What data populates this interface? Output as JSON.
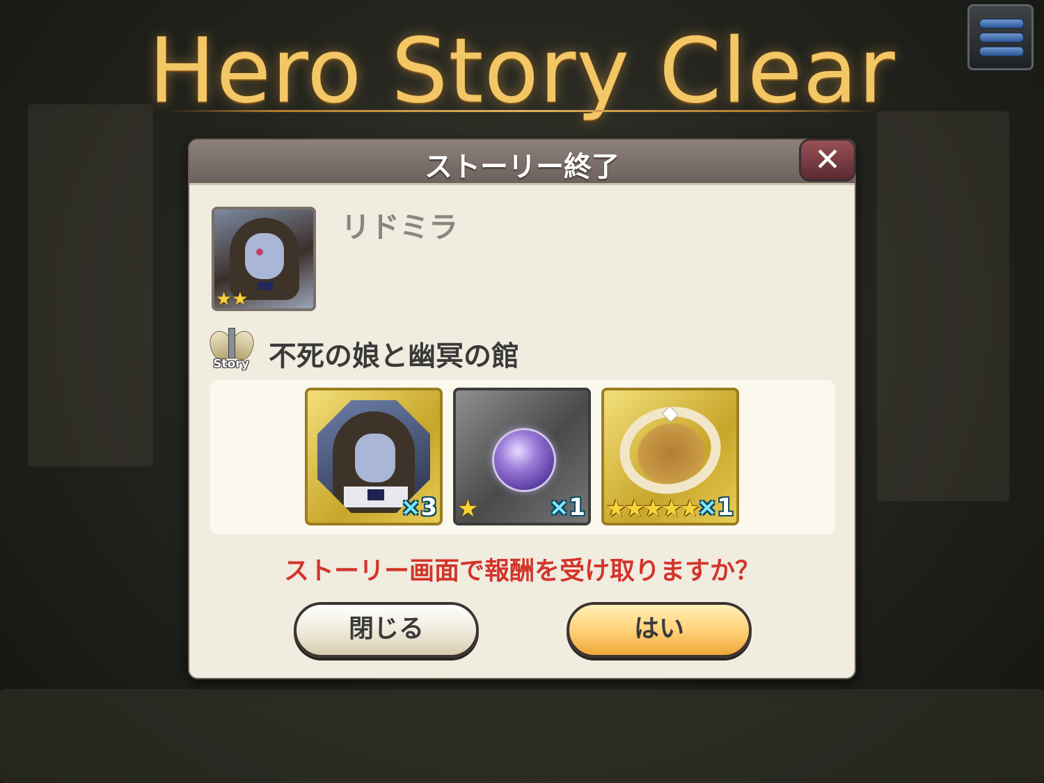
{
  "banner": {
    "title": "Hero Story Clear"
  },
  "menu": {
    "icon": "hamburger-menu-icon"
  },
  "dialog": {
    "title": "ストーリー終了",
    "close_icon": "close-icon",
    "close_glyph": "✕",
    "hero": {
      "name": "リドミラ",
      "rarity_stars": "★★",
      "rarity": 2
    },
    "story": {
      "icon_label": "Story",
      "title": "不死の娘と幽冥の館"
    },
    "rewards": [
      {
        "kind": "hero-portrait",
        "stars": "",
        "count_prefix": "×",
        "count": "3"
      },
      {
        "kind": "purple-orb",
        "stars": "★",
        "count_prefix": "×",
        "count": "1"
      },
      {
        "kind": "gold-ring",
        "stars": "★★★★★",
        "count_prefix": "×",
        "count": "1"
      }
    ],
    "prompt": "ストーリー画面で報酬を受け取りますか？",
    "buttons": {
      "close": "閉じる",
      "yes": "はい"
    }
  },
  "colors": {
    "prompt": "#d3342b",
    "title_gold": "#f3c666",
    "dialog_bg": "#f0ecdf",
    "header_bg": "#7d716b"
  }
}
